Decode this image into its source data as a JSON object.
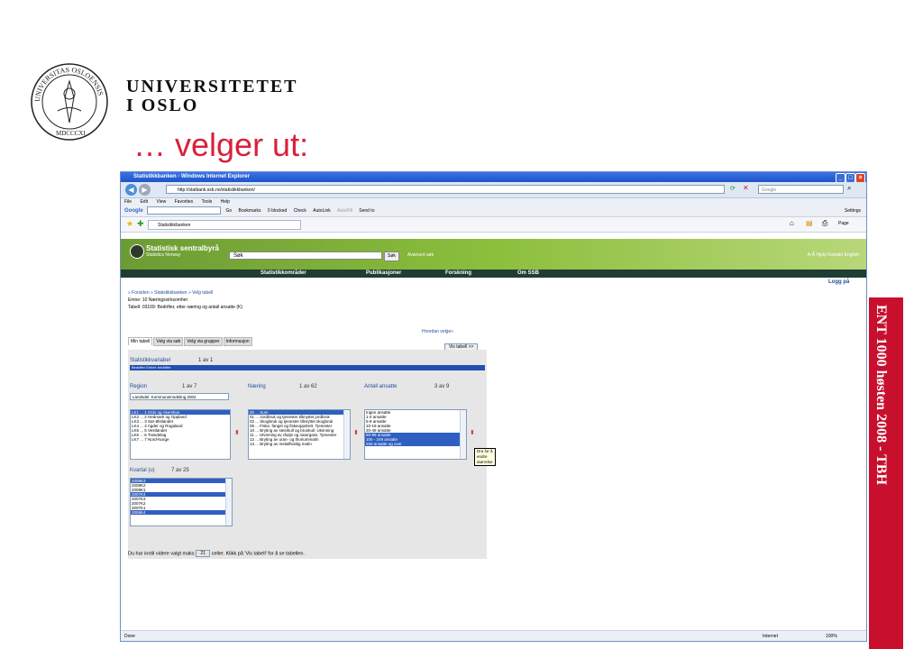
{
  "slide": {
    "university_line1": "UNIVERSITETET",
    "university_line2": "I OSLO",
    "heading": "… velger ut:",
    "side_text": "ENT 1000 høsten 2008 - TBH",
    "seal_text": "UNIVERSITAS OSLOENSIS MDCCCXI"
  },
  "browser": {
    "title": "Statistikkbanken - Windows Internet Explorer",
    "url": "http://statbank.ssb.no/statistikkbanken/",
    "search_placeholder": "Google",
    "menu": [
      "File",
      "Edit",
      "View",
      "Favorites",
      "Tools",
      "Help"
    ],
    "google_label": "Google",
    "toolbar_items": [
      "Go",
      "Bookmarks",
      "0 blocked",
      "Check",
      "AutoLink",
      "AutoFill",
      "Send to"
    ],
    "settings_label": "Settings",
    "tab_label": "Statistikkbanken",
    "page_label": "Page",
    "status_done": "Done",
    "status_zone": "Internet",
    "status_zoom": "100%"
  },
  "ssb": {
    "name": "Statistisk sentralbyrå",
    "name_en": "Statistics Norway",
    "search_value": "Søk",
    "search_button": "Søk",
    "advanced": "Avansert søk",
    "top_links": "A-Å  Hjelp  Kontakt  English",
    "nav": [
      "Statistikkområder",
      "Publikasjoner",
      "Forskning",
      "Om SSB"
    ],
    "logg": "Logg på",
    "breadcrumb": "» Forsiden » Statistikkbanken » Velg tabell",
    "emne": "Emne: 10 Næringsvirksomhet",
    "tabell": "Tabell: 03109: Bedrifter, etter næring og antall ansatte (K)",
    "hvordan": "Hvordan velge»",
    "vis_tabell": "Vis tabell >>",
    "tabs": [
      "Min tabell",
      "Velg via søk",
      "Velg via grupper",
      "Informasjon"
    ],
    "statvar_label": "Statistikkvariabel",
    "statvar_count": "1  av  1",
    "statvar_selected": "Bedrifter     Enhet: bedrifter",
    "region_label": "Region",
    "region_count": "1  av  7",
    "region_dropdown": "Landsdel. Kommuneinndeling 2002",
    "region_items": [
      "LK1 ... 1 Oslo og Akershus",
      "LK2 ... 2 Hedmark og Oppland",
      "LK3 ... 3 Sør-Østlandet",
      "LK4 ... 4 Agder og Rogaland",
      "LK5 ... 5 Vestlandet",
      "LK6 ... 6 Trøndelag",
      "LK7 ... 7 Nord-Norge"
    ],
    "naering_label": "Næring",
    "naering_count": "1  av  62",
    "naering_items": [
      "00 ... Sum",
      "01 ... Jordbruk og tjenester tilknyttet jordbruk",
      "02 ... Skogbruk og tjenester tilknyttet skogbruk",
      "05 ... Fiske, fangst og fiskeoppdrett. Tjenester",
      "10 ... Bryting av steinkull og brunkull. Utvinning",
      "11 ... Utvinning av råolje og naturgass. Tjenester",
      "12 ... Bryting av uran- og thoriummalm",
      "13 ... Bryting av metallholdig malm"
    ],
    "ansatte_label": "Antall ansatte",
    "ansatte_count": "3  av  9",
    "ansatte_items": [
      "Ingen ansatte",
      "1-4 ansatte",
      "5-9 ansatte",
      "10-19 ansatte",
      "20-49 ansatte",
      "50-99 ansatte",
      "100 - 249 ansatte",
      "250 ansatte og over"
    ],
    "tooltip": "Dra for å endre størrelse",
    "kvartal_label": "Kvartal (u)",
    "kvartal_count": "7 av 25",
    "kvartal_items": [
      "2008K3",
      "2008K2",
      "2008K1",
      "2007K4",
      "2007K3",
      "2007K2",
      "2007K1",
      "2006K4"
    ],
    "info_before": "Du har inntil videre valgt maks",
    "info_max": "21",
    "info_after": "celler. Klikk på 'Vis tabell' for å se tabellen."
  }
}
